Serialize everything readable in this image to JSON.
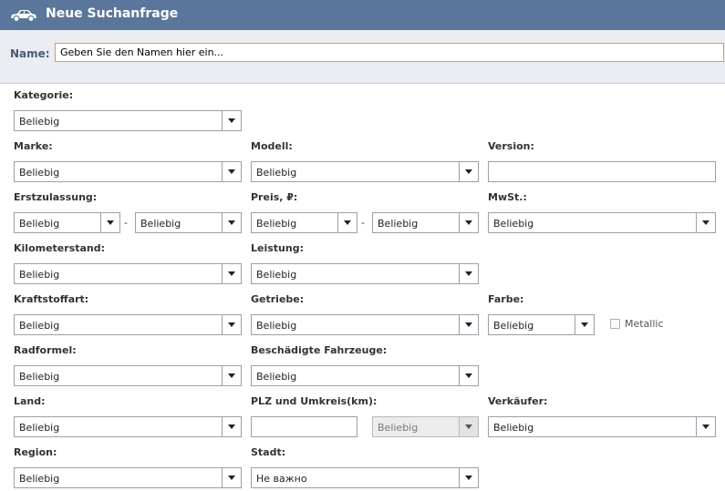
{
  "header": {
    "title": "Neue Suchanfrage",
    "icon": "car-icon"
  },
  "name": {
    "label": "Name:",
    "value": "Geben Sie den Namen hier ein..."
  },
  "labels": {
    "kategorie": "Kategorie:",
    "marke": "Marke:",
    "modell": "Modell:",
    "version": "Version:",
    "erstzulassung": "Erstzulassung:",
    "preis": "Preis, ₽:",
    "mwst": "MwSt.:",
    "kilometerstand": "Kilometerstand:",
    "leistung": "Leistung:",
    "kraftstoffart": "Kraftstoffart:",
    "getriebe": "Getriebe:",
    "farbe": "Farbe:",
    "radformel": "Radformel:",
    "beschaedigte": "Beschädigte Fahrzeuge:",
    "land": "Land:",
    "plz": "PLZ und Umkreis(km):",
    "verkaeufer": "Verkäufer:",
    "region": "Region:",
    "stadt": "Stadt:"
  },
  "values": {
    "kategorie": "Beliebig",
    "marke": "Beliebig",
    "modell": "Beliebig",
    "version": "",
    "erstzulassung_from": "Beliebig",
    "erstzulassung_to": "Beliebig",
    "preis_from": "Beliebig",
    "preis_to": "Beliebig",
    "mwst": "Beliebig",
    "kilometerstand": "Beliebig",
    "leistung": "Beliebig",
    "kraftstoffart": "Beliebig",
    "getriebe": "Beliebig",
    "farbe": "Beliebig",
    "radformel": "Beliebig",
    "beschaedigte": "Beliebig",
    "land": "Beliebig",
    "plz": "",
    "umkreis": "Beliebig",
    "verkaeufer": "Beliebig",
    "region": "Beliebig",
    "stadt": "Не важно"
  },
  "range_separator": "-",
  "metallic": {
    "label": "Metallic",
    "checked": false
  },
  "colors": {
    "header_bg": "#5a769a",
    "name_bar_bg": "#eaedf1",
    "focus_border": "#e59a3e"
  }
}
